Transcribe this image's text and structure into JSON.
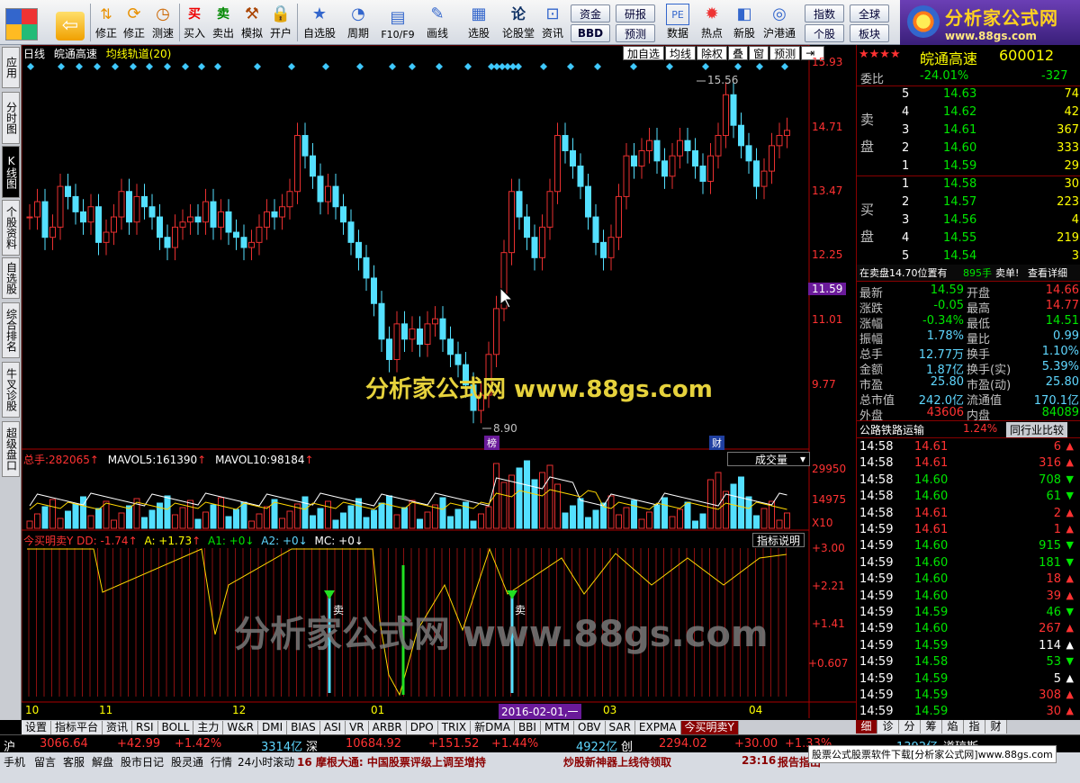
{
  "toolbar": {
    "buttons": [
      "修正",
      "测速",
      "买入",
      "卖出",
      "模拟",
      "开户",
      "自选股",
      "周期",
      "F10/F9",
      "画线",
      "选股",
      "论股堂",
      "资讯",
      "数据",
      "热点",
      "新股",
      "沪港通"
    ],
    "right_buttons": [
      "资金",
      "BBD",
      "研报",
      "预测",
      "指数",
      "个股",
      "全球",
      "板块"
    ],
    "icon_labels": {
      "buy": "买",
      "sell": "卖"
    }
  },
  "logo": {
    "title": "分析家公式网",
    "url": "www.88gs.com"
  },
  "vtabs": [
    "应用",
    "分时图",
    "K线图",
    "个股资料",
    "自选股",
    "综合排名",
    "牛叉诊股",
    "超级盘口"
  ],
  "chart": {
    "header": {
      "period": "日线",
      "name": "皖通高速",
      "indicator": "均线轨道(20)"
    },
    "tools": [
      "加自选",
      "均线",
      "除权",
      "叠",
      "窗",
      "预测"
    ],
    "price_axis": [
      "15.93",
      "14.71",
      "13.47",
      "12.25",
      "11.59",
      "11.01",
      "9.77"
    ],
    "high_label": "15.56",
    "low_label": "8.90",
    "markers": {
      "bang": "榜",
      "cai": "财"
    },
    "watermark": "分析家公式网 www.88gs.com",
    "vol": {
      "total_label": "总手:",
      "total": "282065",
      "ma5_label": "MAVOL5:",
      "ma5": "161390",
      "ma10_label": "MAVOL10:",
      "ma10": "98184",
      "selector": "成交量",
      "axis": [
        "29950",
        "14975",
        "X10"
      ]
    },
    "ind": {
      "name": "今买明卖Y",
      "dd": "DD: -1.74",
      "a": "A: +1.73",
      "a1": "A1: +0",
      "a2": "A2: +0",
      "mc": "MC: +0",
      "help": "指标说明",
      "axis": [
        "+3.00",
        "+2.21",
        "+1.41",
        "+0.607"
      ],
      "sell": "卖"
    },
    "dates": [
      "10",
      "11",
      "12",
      "01",
      "2016-02-01,一",
      "03",
      "04"
    ]
  },
  "bottom_tabs": [
    "设置",
    "指标平台",
    "资讯",
    "RSI",
    "BOLL",
    "主力",
    "W&R",
    "DMI",
    "BIAS",
    "ASI",
    "VR",
    "ARBR",
    "DPO",
    "TRIX",
    "新DMA",
    "BBI",
    "MTM",
    "OBV",
    "SAR",
    "EXPMA",
    "今买明卖Y"
  ],
  "right_tabs": [
    "细",
    "诊",
    "分",
    "筹",
    "焰",
    "指",
    "财"
  ],
  "panel": {
    "stock": {
      "stars": "★★★★",
      "name": "皖通高速",
      "code": "600012"
    },
    "weibi": {
      "label": "委比",
      "pct": "-24.01%",
      "diff": "-327"
    },
    "sell": [
      {
        "n": "5",
        "p": "14.63",
        "v": "74"
      },
      {
        "n": "4",
        "p": "14.62",
        "v": "42"
      },
      {
        "n": "3",
        "p": "14.61",
        "v": "367"
      },
      {
        "n": "2",
        "p": "14.60",
        "v": "333"
      },
      {
        "n": "1",
        "p": "14.59",
        "v": "29"
      }
    ],
    "buy": [
      {
        "n": "1",
        "p": "14.58",
        "v": "30"
      },
      {
        "n": "2",
        "p": "14.57",
        "v": "223"
      },
      {
        "n": "3",
        "p": "14.56",
        "v": "4"
      },
      {
        "n": "4",
        "p": "14.55",
        "v": "219"
      },
      {
        "n": "5",
        "p": "14.54",
        "v": "3"
      }
    ],
    "sell_label": "卖盘",
    "buy_label": "买盘",
    "notice": {
      "text": "在卖盘14.70位置有",
      "num": "895手",
      "tail": "卖单!",
      "link": "查看详细"
    },
    "quote": [
      [
        "最新",
        "14.59",
        "开盘",
        "14.66"
      ],
      [
        "涨跌",
        "-0.05",
        "最高",
        "14.77"
      ],
      [
        "涨幅",
        "-0.34%",
        "最低",
        "14.51"
      ],
      [
        "振幅",
        "1.78%",
        "量比",
        "0.99"
      ],
      [
        "总手",
        "12.77万",
        "换手",
        "1.10%"
      ],
      [
        "金额",
        "1.87亿",
        "换手(实)",
        "5.39%"
      ],
      [
        "市盈",
        "25.80",
        "市盈(动)",
        "25.80"
      ],
      [
        "总市值",
        "242.0亿",
        "流通值",
        "170.1亿"
      ],
      [
        "外盘",
        "43606",
        "内盘",
        "84089"
      ]
    ],
    "industry": {
      "name": "公路铁路运输",
      "pct": "1.24%",
      "btn": "同行业比较"
    },
    "ticks": [
      [
        "14:58",
        "14.61",
        "6",
        "up"
      ],
      [
        "14:58",
        "14.61",
        "316",
        "up"
      ],
      [
        "14:58",
        "14.60",
        "708",
        "down"
      ],
      [
        "14:58",
        "14.60",
        "61",
        "down"
      ],
      [
        "14:58",
        "14.61",
        "2",
        "up"
      ],
      [
        "14:59",
        "14.61",
        "1",
        "up"
      ],
      [
        "14:59",
        "14.60",
        "915",
        "down"
      ],
      [
        "14:59",
        "14.60",
        "181",
        "down"
      ],
      [
        "14:59",
        "14.60",
        "18",
        "up"
      ],
      [
        "14:59",
        "14.60",
        "39",
        "up"
      ],
      [
        "14:59",
        "14.59",
        "46",
        "down"
      ],
      [
        "14:59",
        "14.60",
        "267",
        "up"
      ],
      [
        "14:59",
        "14.59",
        "114",
        "neutral"
      ],
      [
        "14:59",
        "14.58",
        "53",
        "down"
      ],
      [
        "14:59",
        "14.59",
        "5",
        "neutral"
      ],
      [
        "14:59",
        "14.59",
        "308",
        "up"
      ],
      [
        "14:59",
        "14.59",
        "30",
        "up"
      ]
    ]
  },
  "status": {
    "sh": "沪",
    "sh_idx": "3066.64",
    "sh_chg": "+42.99",
    "sh_pct": "+1.42%",
    "sh_amt": "3314亿",
    "sz": "深",
    "sz_idx": "10684.92",
    "sz_chg": "+151.52",
    "sz_pct": "+1.44%",
    "sz_amt": "4922亿",
    "cy": "创",
    "cy_idx": "2294.02",
    "cy_chg": "+30.00",
    "cy_pct": "+1.33%",
    "ex_amt": "1392亿",
    "ex_name": "道琼斯"
  },
  "ticker": {
    "items": [
      "手机",
      "留言",
      "客服",
      "解盘",
      "股市日记",
      "股灵通",
      "行情",
      "24小时滚动"
    ],
    "news1": "16 摩根大通: 中国股票评级上调至增持",
    "news2": "炒股新神器上线待领取",
    "time": "23:16",
    "news3": "报告指出",
    "ad": "股票公式股票软件下载[分析家公式网]www.88gs.com"
  }
}
